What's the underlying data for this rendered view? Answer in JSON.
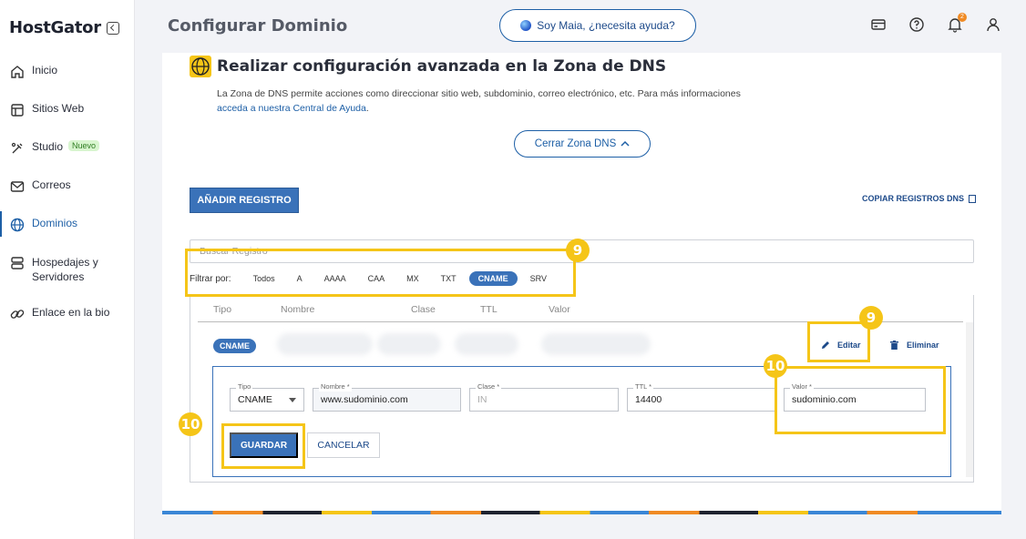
{
  "brand": {
    "name": "HostGator"
  },
  "sidebar": {
    "items": [
      {
        "label": "Inicio",
        "icon": "home-icon"
      },
      {
        "label": "Sitios Web",
        "icon": "website-icon"
      },
      {
        "label": "Studio",
        "icon": "studio-icon",
        "badge": "Nuevo"
      },
      {
        "label": "Correos",
        "icon": "mail-icon"
      },
      {
        "label": "Dominios",
        "icon": "globe-icon",
        "active": true
      },
      {
        "label": "Hospedajes y Servidores",
        "icon": "server-icon"
      },
      {
        "label": "Enlace en la bio",
        "icon": "link-icon"
      }
    ]
  },
  "header": {
    "title": "Configurar Dominio",
    "maia_label": "Soy Maia, ¿necesita ayuda?",
    "notifications_count": "2"
  },
  "dns_section": {
    "title": "Realizar configuración avanzada en la Zona de DNS",
    "description": "La Zona de DNS permite acciones como direccionar sitio web, subdominio, correo electrónico, etc. Para más informaciones",
    "help_link": "acceda a nuestra Central de Ayuda",
    "help_link_suffix": ".",
    "close_button": "Cerrar Zona DNS",
    "add_button": "AÑADIR REGISTRO",
    "copy_link": "COPIAR REGISTROS DNS",
    "search_placeholder": "Buscar Registro",
    "filter_label": "Filtrar por:",
    "filters": [
      "Todos",
      "A",
      "AAAA",
      "CAA",
      "MX",
      "TXT",
      "CNAME",
      "SRV"
    ],
    "active_filter": "CNAME"
  },
  "table": {
    "columns": [
      "Tipo",
      "Nombre",
      "Clase",
      "TTL",
      "Valor"
    ],
    "row": {
      "type": "CNAME",
      "edit_label": "Editar",
      "delete_label": "Eliminar"
    }
  },
  "edit_form": {
    "tipo_label": "Tipo",
    "tipo_value": "CNAME",
    "nombre_label": "Nombre *",
    "nombre_value": "www.sudominio.com",
    "clase_label": "Clase *",
    "clase_value": "IN",
    "ttl_label": "TTL *",
    "ttl_value": "14400",
    "valor_label": "Valor *",
    "valor_value": "sudominio.com",
    "save_label": "GUARDAR",
    "cancel_label": "CANCELAR"
  },
  "annotations": {
    "step_a": "9",
    "step_b": "10"
  },
  "colors": {
    "accent": "#3a72b9",
    "highlight": "#f5c518",
    "brand_dark": "#1f2330"
  }
}
